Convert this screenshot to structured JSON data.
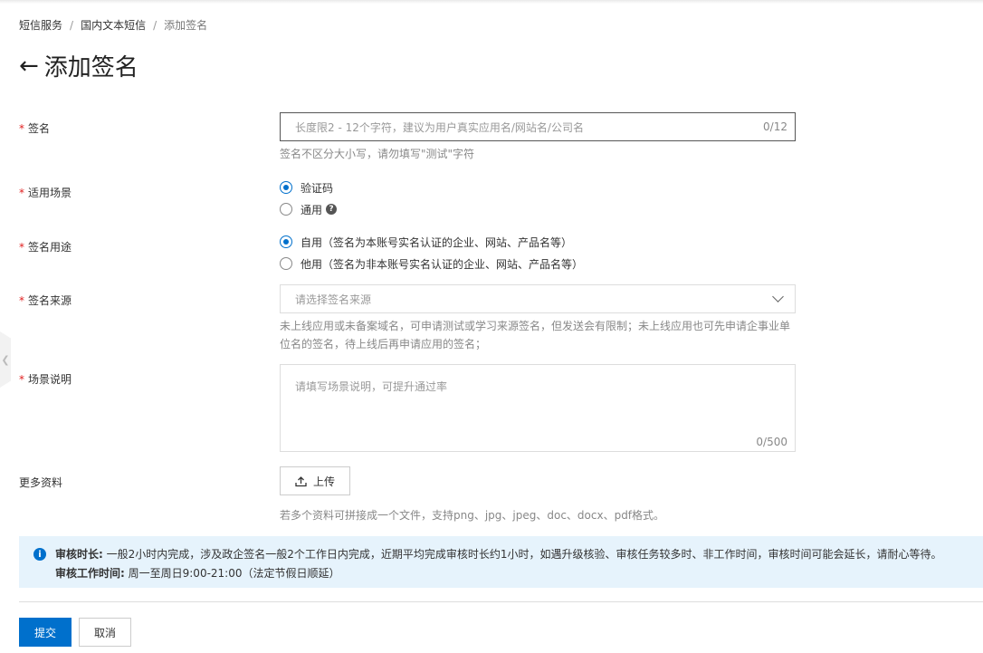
{
  "breadcrumb": [
    "短信服务",
    "国内文本短信",
    "添加签名"
  ],
  "page_title": "添加签名",
  "form": {
    "signature": {
      "label": "签名",
      "placeholder": "长度限2 - 12个字符，建议为用户真实应用名/网站名/公司名",
      "counter": "0/12",
      "help": "签名不区分大小写，请勿填写\"测试\"字符"
    },
    "scene": {
      "label": "适用场景",
      "options": [
        "验证码",
        "通用"
      ],
      "selected": "验证码"
    },
    "purpose": {
      "label": "签名用途",
      "options": [
        "自用（签名为本账号实名认证的企业、网站、产品名等）",
        "他用（签名为非本账号实名认证的企业、网站、产品名等）"
      ],
      "selected": "自用（签名为本账号实名认证的企业、网站、产品名等）"
    },
    "source": {
      "label": "签名来源",
      "placeholder": "请选择签名来源",
      "help_line1": "未上线应用或未备案域名，可申请测试或学习来源签名，但发送会有限制；未上线应用也可先申请企事业单",
      "help_line2": "位名的签名，待上线后再申请应用的签名；"
    },
    "description": {
      "label": "场景说明",
      "placeholder": "请填写场景说明，可提升通过率",
      "counter": "0/500"
    },
    "more": {
      "label": "更多资料",
      "upload_label": "上传",
      "help": "若多个资料可拼接成一个文件，支持png、jpg、jpeg、doc、docx、pdf格式。"
    }
  },
  "notice": {
    "line1_title": "审核时长:",
    "line1_text": " 一般2小时内完成，涉及政企签名一般2个工作日内完成，近期平均完成审核时长约1小时，如遇升级核验、审核任务较多时、非工作时间，审核时间可能会延长，请耐心等待。",
    "line2_title": "审核工作时间:",
    "line2_text": " 周一至周日9:00-21:00（法定节假日顺延）"
  },
  "actions": {
    "submit": "提交",
    "cancel": "取消"
  },
  "colors": {
    "primary": "#0070cc",
    "required": "#e02020",
    "notice_bg": "#e6f3fc"
  }
}
